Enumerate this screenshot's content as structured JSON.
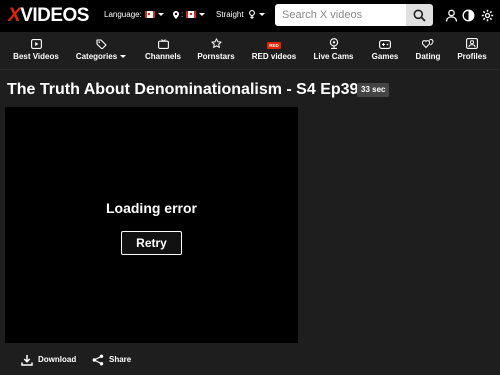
{
  "header": {
    "logo_x": "X",
    "logo_rest": "VIDEOS",
    "language_label": "Language:",
    "country_sep": ":",
    "orientation_label": "Straight",
    "search": {
      "placeholder": "Search X videos",
      "value": ""
    }
  },
  "nav": {
    "items": [
      {
        "label": "Best Videos",
        "icon": "play-box-icon"
      },
      {
        "label": "Categories",
        "icon": "tags-icon",
        "dropdown": true
      },
      {
        "label": "Channels",
        "icon": "tv-icon"
      },
      {
        "label": "Pornstars",
        "icon": "star-icon"
      },
      {
        "label": "RED videos",
        "icon": "red-badge-icon",
        "badge": "RED"
      },
      {
        "label": "Live Cams",
        "icon": "webcam-icon"
      },
      {
        "label": "Games",
        "icon": "gamepad-icon"
      },
      {
        "label": "Dating",
        "icon": "hearts-icon"
      },
      {
        "label": "Profiles",
        "icon": "profiles-icon"
      }
    ]
  },
  "video": {
    "title": "The Truth About Denominationalism - S4 Ep39",
    "duration": "33 sec",
    "error_text": "Loading error",
    "retry_label": "Retry"
  },
  "actions": {
    "download_label": "Download",
    "share_label": "Share"
  },
  "colors": {
    "brand_red": "#de2600",
    "topbar_bg": "#000000",
    "page_bg": "#1e1e1e",
    "player_bg": "#000000",
    "duration_badge_bg": "#444444"
  }
}
